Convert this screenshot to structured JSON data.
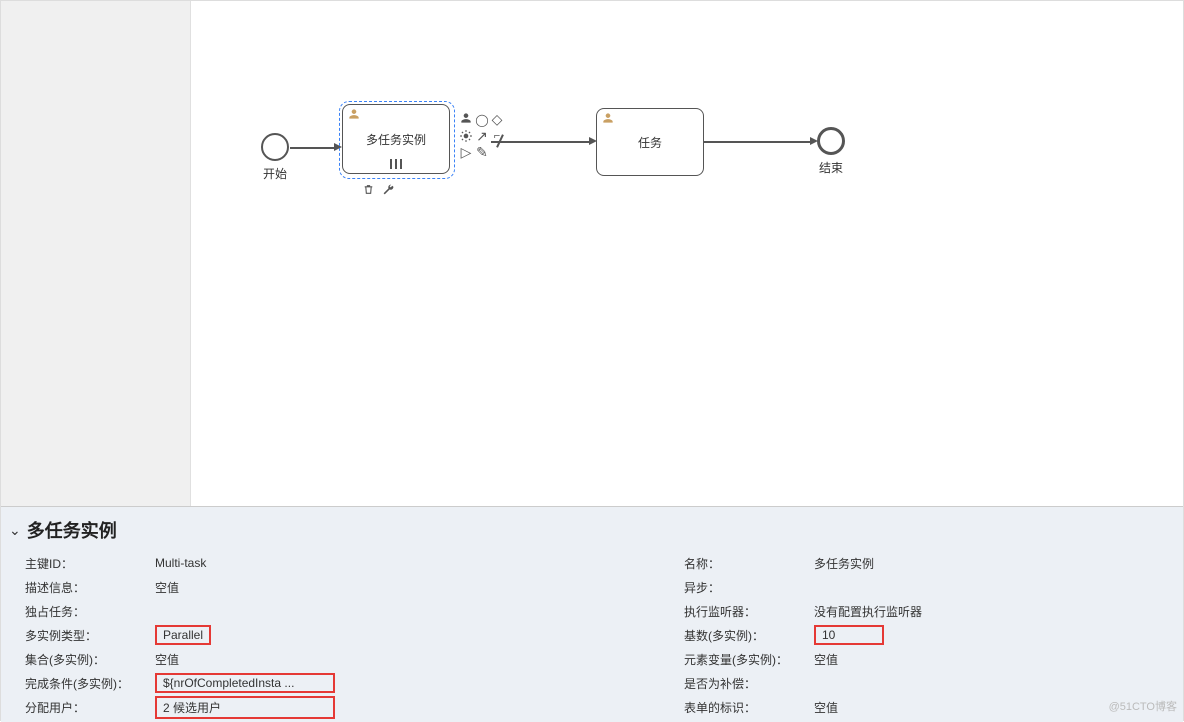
{
  "diagram": {
    "start_label": "开始",
    "task1_label": "多任务实例",
    "task2_label": "任务",
    "end_label": "结束"
  },
  "panel": {
    "title": "多任务实例",
    "left": {
      "id_label": "主键ID：",
      "id_value": "Multi-task",
      "desc_label": "描述信息：",
      "desc_value": "空值",
      "exclusive_label": "独占任务：",
      "multi_type_label": "多实例类型：",
      "multi_type_value": "Parallel",
      "collection_label": "集合(多实例)：",
      "collection_value": "空值",
      "complete_label": "完成条件(多实例)：",
      "complete_value": "${nrOfCompletedInsta ...",
      "assign_label": "分配用户：",
      "assign_value": "2 候选用户"
    },
    "right": {
      "name_label": "名称：",
      "name_value": "多任务实例",
      "async_label": "异步：",
      "listener_label": "执行监听器：",
      "listener_value": "没有配置执行监听器",
      "card_label": "基数(多实例)：",
      "card_value": "10",
      "elemvar_label": "元素变量(多实例)：",
      "elemvar_value": "空值",
      "compensate_label": "是否为补偿：",
      "formkey_label": "表单的标识：",
      "formkey_value": "空值"
    }
  },
  "watermark": "@51CTO博客"
}
